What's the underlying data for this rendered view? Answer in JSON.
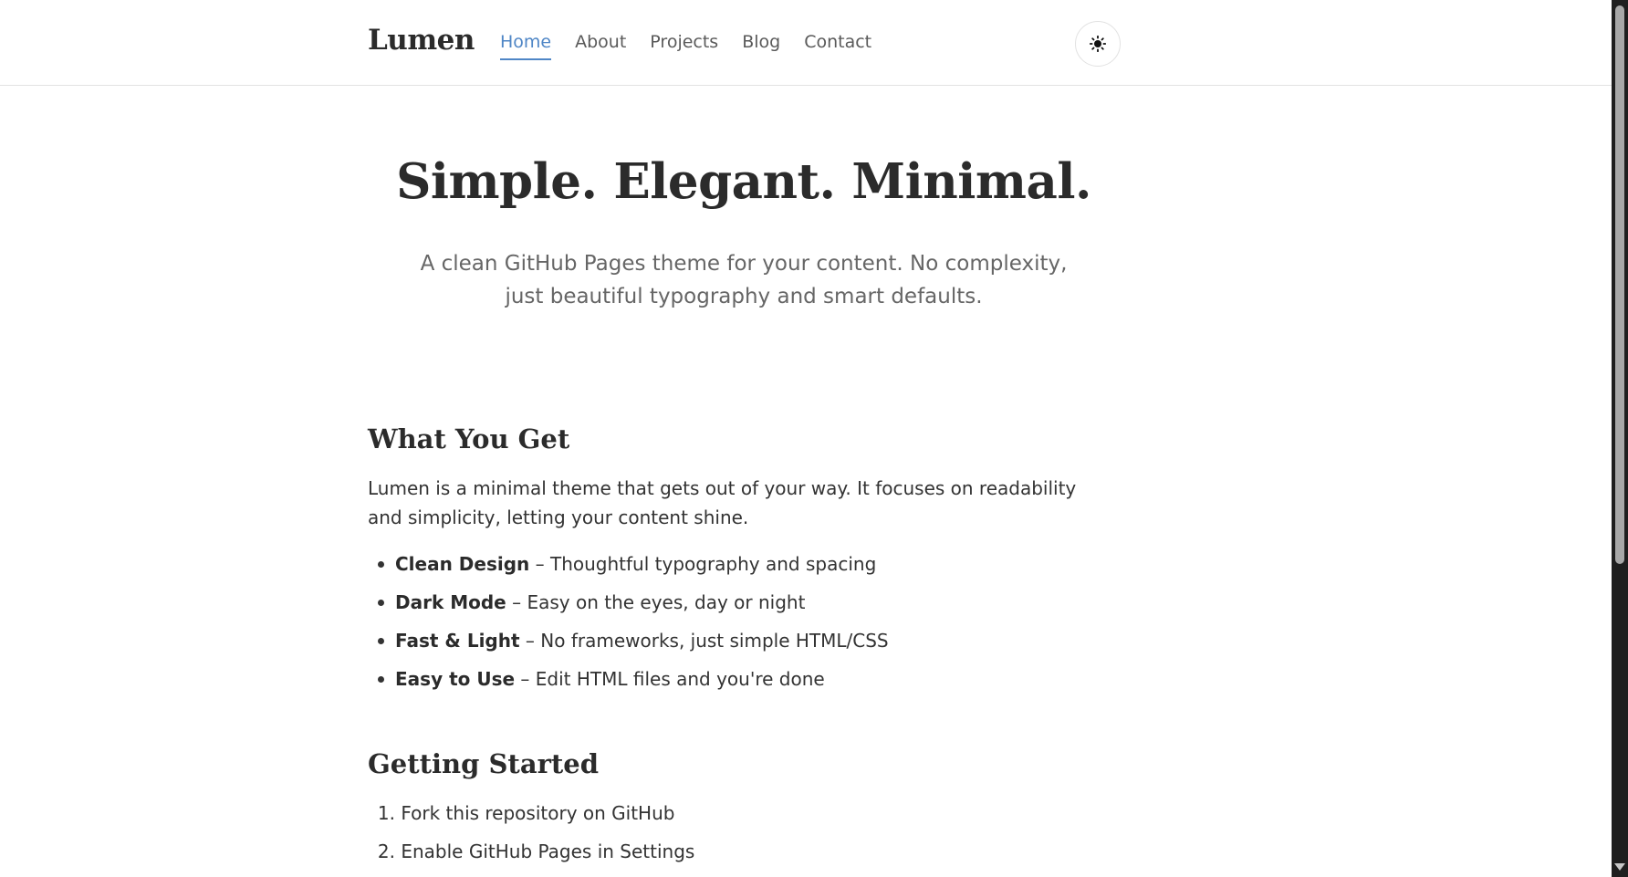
{
  "header": {
    "brand": "Lumen",
    "nav": [
      {
        "label": "Home",
        "active": true
      },
      {
        "label": "About",
        "active": false
      },
      {
        "label": "Projects",
        "active": false
      },
      {
        "label": "Blog",
        "active": false
      },
      {
        "label": "Contact",
        "active": false
      }
    ],
    "theme_toggle_icon": "sun-icon"
  },
  "hero": {
    "title": "Simple. Elegant. Minimal.",
    "subtitle": "A clean GitHub Pages theme for your content. No complexity, just beautiful typography and smart defaults."
  },
  "features_section": {
    "heading": "What You Get",
    "intro": "Lumen is a minimal theme that gets out of your way. It focuses on readability and simplicity, letting your content shine.",
    "items": [
      {
        "term": "Clean Design",
        "description": " – Thoughtful typography and spacing"
      },
      {
        "term": "Dark Mode",
        "description": " – Easy on the eyes, day or night"
      },
      {
        "term": "Fast & Light",
        "description": " – No frameworks, just simple HTML/CSS"
      },
      {
        "term": "Easy to Use",
        "description": " – Edit HTML files and you're done"
      }
    ]
  },
  "getting_started": {
    "heading": "Getting Started",
    "steps": [
      {
        "number": "1.",
        "text": "Fork this repository on GitHub"
      },
      {
        "number": "2.",
        "text": "Enable GitHub Pages in Settings"
      }
    ]
  },
  "colors": {
    "accent": "#4f86c6",
    "text": "#2b2b2b",
    "muted": "#666666",
    "border": "#e3e3e3"
  }
}
